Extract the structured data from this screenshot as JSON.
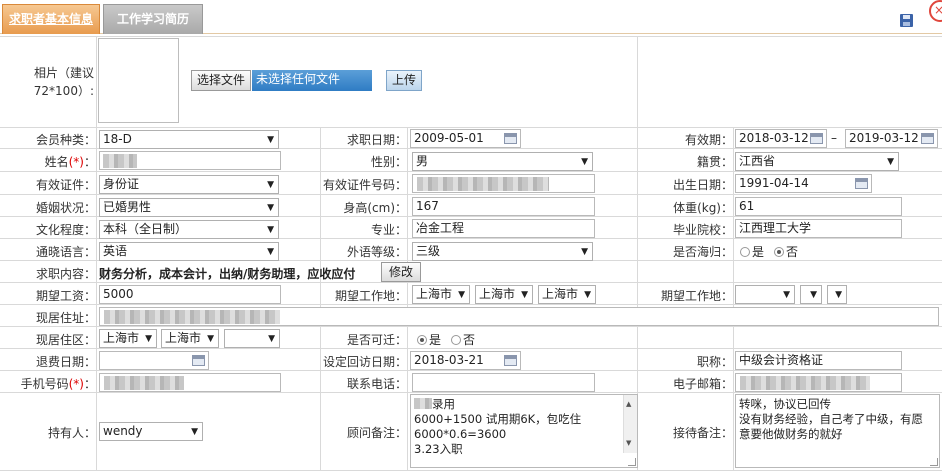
{
  "tabs": {
    "basic_info": "求职者基本信息",
    "resume": "工作学习简历"
  },
  "photo": {
    "label": "相片（建议72*100）:",
    "choose_button": "选择文件",
    "file_status": "未选择任何文件",
    "upload_button": "上传"
  },
  "member_type": {
    "label": "会员种类：",
    "value": "18-D"
  },
  "apply_date": {
    "label": "求职日期：",
    "value": "2009-05-01"
  },
  "validity": {
    "label": "有效期：",
    "start": "2018-03-12",
    "sep": "–",
    "end": "2019-03-12"
  },
  "name": {
    "label_pre": "姓名",
    "label_req": "(*)",
    "label_post": "："
  },
  "gender": {
    "label": "性别：",
    "value": "男"
  },
  "native_place": {
    "label": "籍贯：",
    "value": "江西省"
  },
  "id_type": {
    "label": "有效证件：",
    "value": "身份证"
  },
  "id_number": {
    "label": "有效证件号码："
  },
  "birth_date": {
    "label": "出生日期：",
    "value": "1991-04-14"
  },
  "marital": {
    "label": "婚姻状况：",
    "value": "已婚男性"
  },
  "height": {
    "label": "身高(cm)：",
    "value": "167"
  },
  "weight": {
    "label": "体重(kg)：",
    "value": "61"
  },
  "education": {
    "label": "文化程度：",
    "value": "本科（全日制）"
  },
  "major": {
    "label": "专业：",
    "value": "冶金工程"
  },
  "school": {
    "label": "毕业院校：",
    "value": "江西理工大学"
  },
  "language": {
    "label": "通晓语言：",
    "value": "英语"
  },
  "foreign_level": {
    "label": "外语等级：",
    "value": "三级"
  },
  "returnee": {
    "label": "是否海归：",
    "yes": "是",
    "no": "否"
  },
  "job_content": {
    "label": "求职内容：",
    "value": "财务分析，成本会计，出纳/财务助理，应收应付",
    "edit_button": "修改"
  },
  "salary": {
    "label": "期望工资：",
    "value": "5000"
  },
  "work_place_1": {
    "label": "期望工作地：",
    "city1": "上海市",
    "city2": "上海市",
    "city3": "上海市"
  },
  "work_place_2": {
    "label": "期望工作地："
  },
  "address": {
    "label": "现居住址："
  },
  "residence": {
    "label": "现居住区：",
    "city1": "上海市",
    "city2": "上海市"
  },
  "relocate": {
    "label": "是否可迁：",
    "yes": "是",
    "no": "否"
  },
  "refund_date": {
    "label": "退费日期："
  },
  "revisit_date": {
    "label": "设定回访日期：",
    "value": "2018-03-21"
  },
  "title": {
    "label": "职称：",
    "value": "中级会计资格证"
  },
  "phone": {
    "label_pre": "手机号码",
    "label_req": "(*)",
    "label_post": "："
  },
  "contact_phone": {
    "label": "联系电话："
  },
  "email": {
    "label": "电子邮箱："
  },
  "holder": {
    "label": "持有人：",
    "value": "wendy"
  },
  "consultant_note": {
    "label": "顾问备注：",
    "line1": "录用",
    "line2": "6000+1500 试用期6K，包吃住",
    "line3": "6000*0.6=3600",
    "line4": "3.23入职"
  },
  "reception_note": {
    "label": "接待备注：",
    "line1": "转咪，协议已回传",
    "line2": "没有财务经验，自己考了中级，有愿意要他做财务的就好"
  }
}
